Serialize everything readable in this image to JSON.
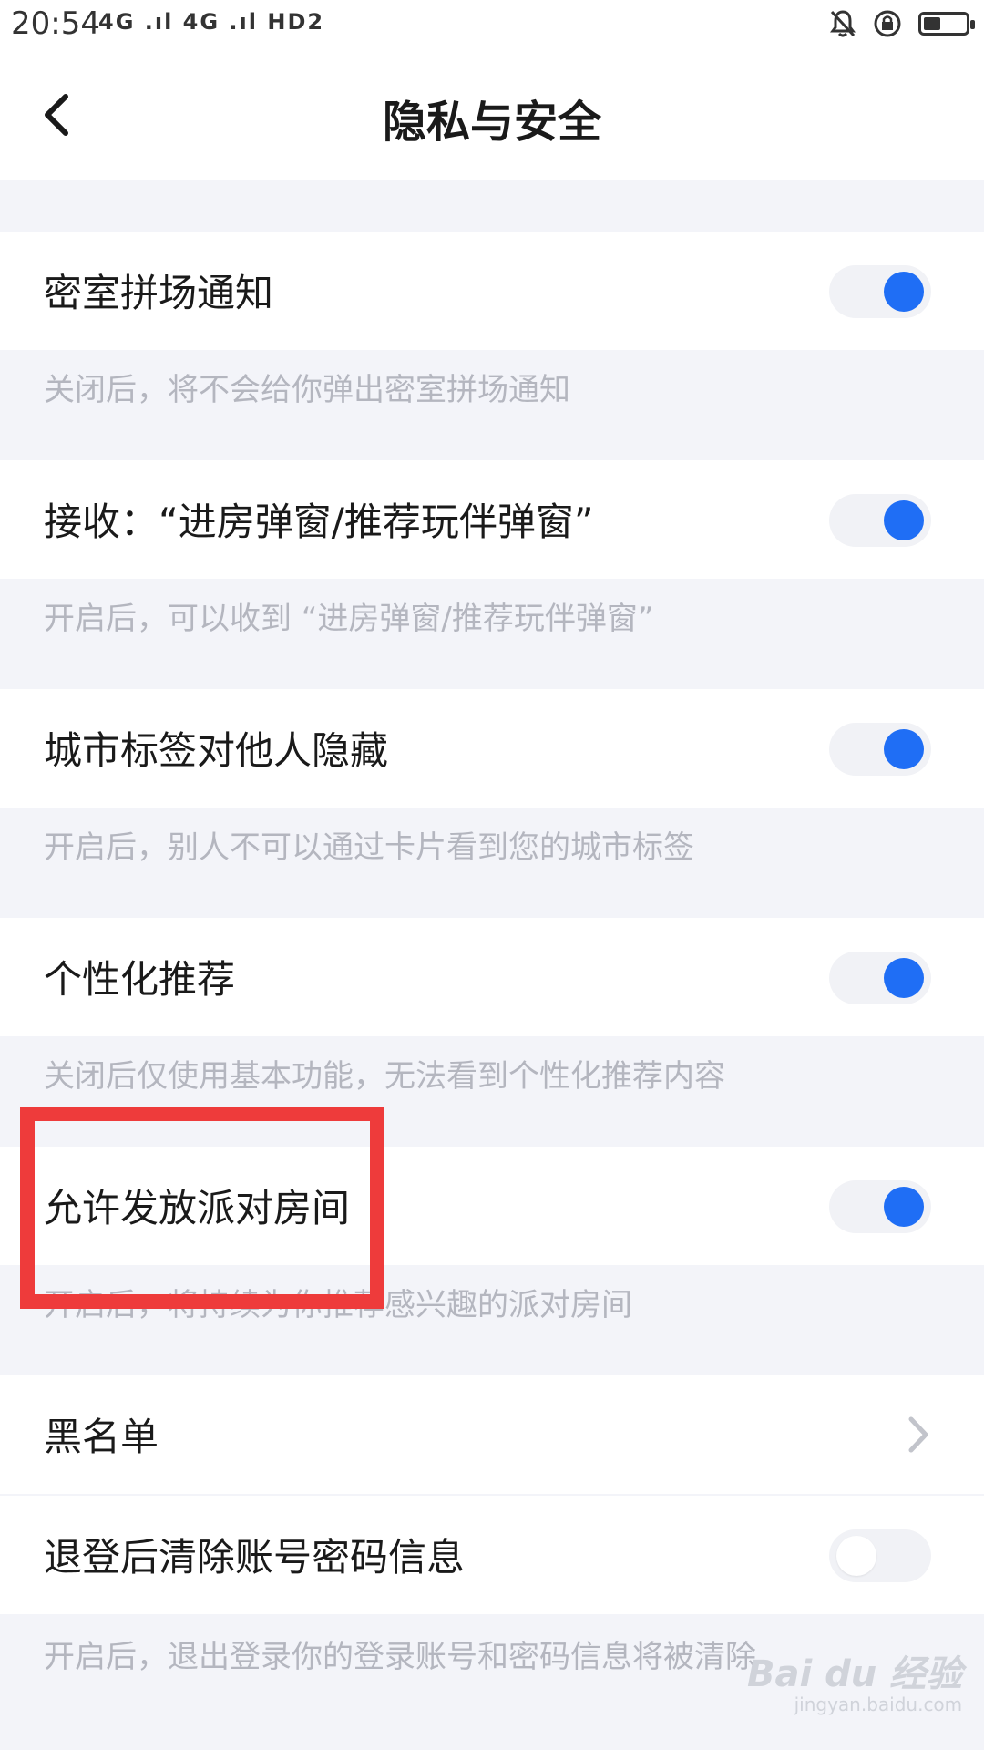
{
  "status_bar": {
    "time": "20:54",
    "icons_text": "4G .ıl 4G .ıl  HD2",
    "right_icons": [
      "bell-off-icon",
      "rotation-lock-icon",
      "battery-icon"
    ],
    "battery_level": 0.42
  },
  "header": {
    "title": "隐私与安全",
    "back_icon": "back-arrow-icon"
  },
  "settings": [
    {
      "label": "密室拼场通知",
      "toggle": "on",
      "description": "关闭后，将不会给你弹出密室拼场通知"
    },
    {
      "label": "接收：“进房弹窗/推荐玩伴弹窗”",
      "toggle": "on",
      "description": "开启后，可以收到 “进房弹窗/推荐玩伴弹窗”"
    },
    {
      "label": "城市标签对他人隐藏",
      "toggle": "on",
      "description": "开启后，别人不可以通过卡片看到您的城市标签"
    },
    {
      "label": "个性化推荐",
      "toggle": "on",
      "description": "关闭后仅使用基本功能，无法看到个性化推荐内容"
    },
    {
      "label": "允许发放派对房间",
      "toggle": "on",
      "description": "开启后，将持续为你推荐感兴趣的派对房间"
    }
  ],
  "blacklist": {
    "label": "黑名单",
    "icon": "chevron-right-icon"
  },
  "clear_account": {
    "label": "退登后清除账号密码信息",
    "toggle": "off",
    "description": "开启后，退出登录你的登录账号和密码信息将被清除"
  },
  "colors": {
    "accent": "#1f6ef5",
    "highlight_box": "#ee3b3b",
    "background": "#f3f4f9",
    "description_text": "#b4b6bf"
  },
  "watermark": {
    "logo": "Bai du 经验",
    "url": "jingyan.baidu.com"
  }
}
